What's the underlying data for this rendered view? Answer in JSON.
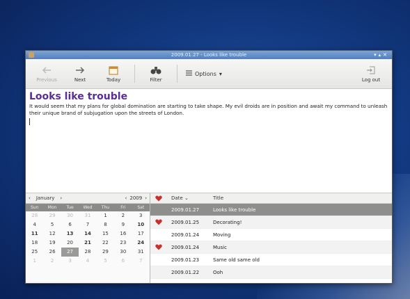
{
  "window": {
    "title": "2009.01.27 - Looks like trouble"
  },
  "toolbar": {
    "previous_label": "Previous",
    "next_label": "Next",
    "today_label": "Today",
    "filter_label": "Filter",
    "options_label": "Options",
    "logout_label": "Log out"
  },
  "entry": {
    "title": "Looks like trouble",
    "body": "It would seem that my plans for global domination are starting to take shape. My evil droids are in position and await my command to unleash their unique brand of subjugation upon the streets of London."
  },
  "calendar": {
    "month": "January",
    "year": "2009",
    "weekdays": [
      "Sun",
      "Mon",
      "Tue",
      "Wed",
      "Thu",
      "Fri",
      "Sat"
    ],
    "days": [
      "28",
      "29",
      "30",
      "31",
      "1",
      "2",
      "3",
      "4",
      "5",
      "6",
      "7",
      "8",
      "9",
      "10",
      "11",
      "12",
      "13",
      "14",
      "15",
      "16",
      "17",
      "18",
      "19",
      "20",
      "21",
      "22",
      "23",
      "24",
      "25",
      "26",
      "27",
      "28",
      "29",
      "30",
      "31",
      "1",
      "2",
      "3",
      "4",
      "5",
      "6",
      "7"
    ]
  },
  "list": {
    "headers": {
      "date": "Date",
      "title": "Title"
    },
    "rows": [
      {
        "date": "2009.01.27",
        "title": "Looks like trouble",
        "favorite": false,
        "selected": true
      },
      {
        "date": "2009.01.25",
        "title": "Decorating!",
        "favorite": true,
        "selected": false
      },
      {
        "date": "2009.01.24",
        "title": "Moving",
        "favorite": false,
        "selected": false
      },
      {
        "date": "2009.01.24",
        "title": "Music",
        "favorite": true,
        "selected": false
      },
      {
        "date": "2009.01.23",
        "title": "Same old same old",
        "favorite": false,
        "selected": false
      },
      {
        "date": "2009.01.22",
        "title": "Ooh",
        "favorite": false,
        "selected": false
      }
    ]
  },
  "colors": {
    "title_purple": "#5a2d9a",
    "heart_red": "#c8302a"
  }
}
